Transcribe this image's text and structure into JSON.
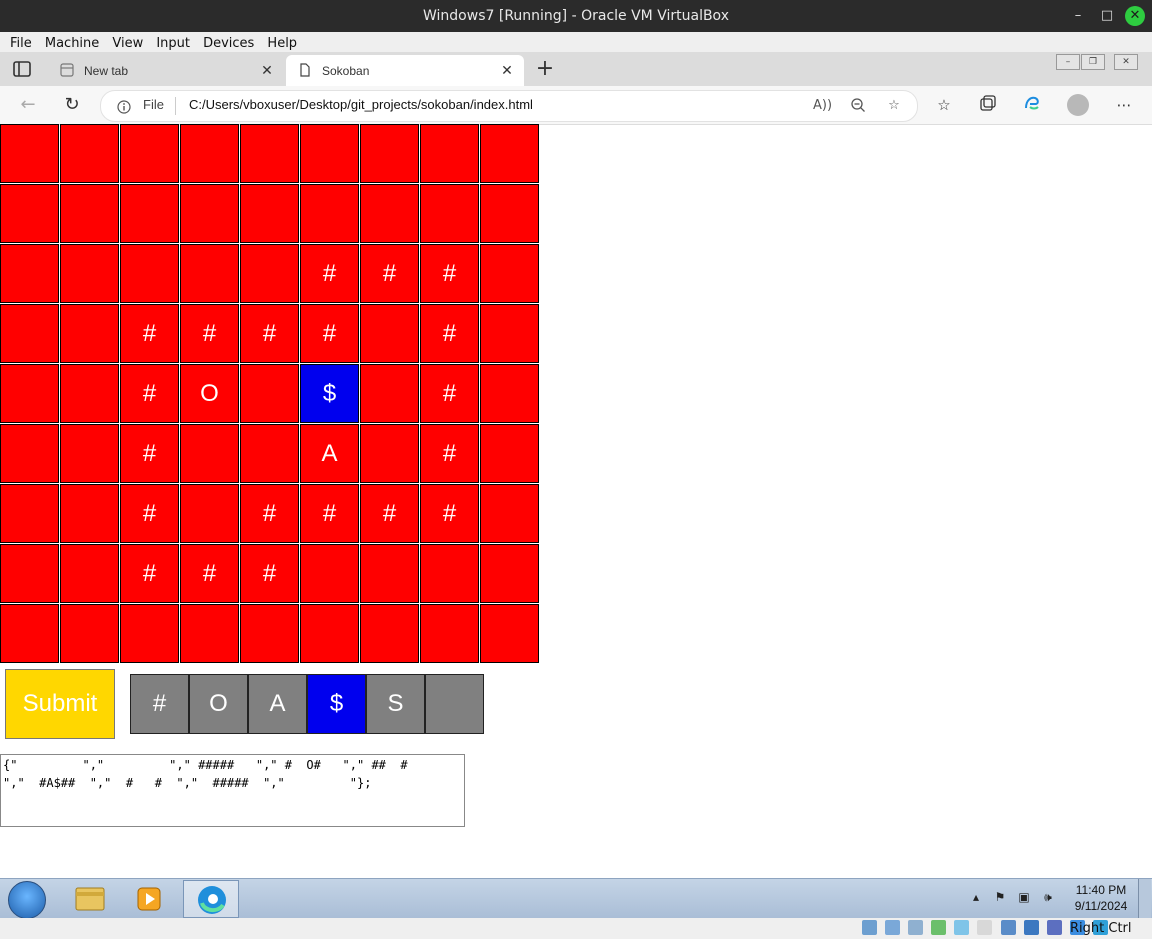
{
  "window": {
    "title": "Windows7 [Running] - Oracle VM VirtualBox",
    "minimize_glyph": "–",
    "maximize_glyph": "□",
    "close_glyph": "✕"
  },
  "vb_menu": [
    "File",
    "Machine",
    "View",
    "Input",
    "Devices",
    "Help"
  ],
  "browser": {
    "tabs": [
      {
        "label": "New tab",
        "icon": "newtab-icon",
        "active": false
      },
      {
        "label": "Sokoban",
        "icon": "page-icon",
        "active": true
      }
    ],
    "tab_close_glyph": "✕",
    "new_tab_glyph": "+",
    "scheme_label": "File",
    "url": "C:/Users/vboxuser/Desktop/git_projects/sokoban/index.html",
    "toolbar_icons": [
      "read-aloud-icon",
      "zoom-out-icon",
      "add-favorite-icon",
      "favorites-icon",
      "collections-icon",
      "edge-copilot-icon",
      "profile-icon",
      "more-icon"
    ]
  },
  "board": {
    "rows": [
      [
        "",
        "",
        "",
        "",
        "",
        "",
        "",
        "",
        ""
      ],
      [
        "",
        "",
        "",
        "",
        "",
        "",
        "",
        "",
        ""
      ],
      [
        "",
        "",
        "",
        "",
        "",
        "#",
        "#",
        "#",
        ""
      ],
      [
        "",
        "",
        "#",
        "#",
        "#",
        "#",
        "",
        "#",
        ""
      ],
      [
        "",
        "",
        "#",
        "O",
        "",
        "$",
        "",
        "#",
        ""
      ],
      [
        "",
        "",
        "#",
        "",
        "",
        "A",
        "",
        "#",
        ""
      ],
      [
        "",
        "",
        "#",
        "",
        "#",
        "#",
        "#",
        "#",
        ""
      ],
      [
        "",
        "",
        "#",
        "#",
        "#",
        "",
        "",
        "",
        ""
      ],
      [
        "",
        "",
        "",
        "",
        "",
        "",
        "",
        "",
        ""
      ]
    ],
    "selected_cell": [
      4,
      5
    ],
    "cell_color": "#ff0000",
    "selected_color": "#0000ee"
  },
  "controls": {
    "submit_label": "Submit",
    "submit_color": "#ffd700",
    "palette": [
      "#",
      "O",
      "A",
      "$",
      "S",
      ""
    ],
    "palette_selected": 3,
    "palette_color": "#808080"
  },
  "level_text": "{\"         \",\"         \",\" #####   \",\" #  O#   \",\" ##  #\n\",\"  #A$##  \",\"  #   #  \",\"  #####  \",\"         \"};",
  "taskbar": {
    "apps": [
      "windows-explorer-icon",
      "media-player-icon",
      "edge-icon"
    ],
    "time": "11:40 PM",
    "date": "9/11/2024"
  },
  "vb_status": {
    "host_key": "Right Ctrl"
  }
}
